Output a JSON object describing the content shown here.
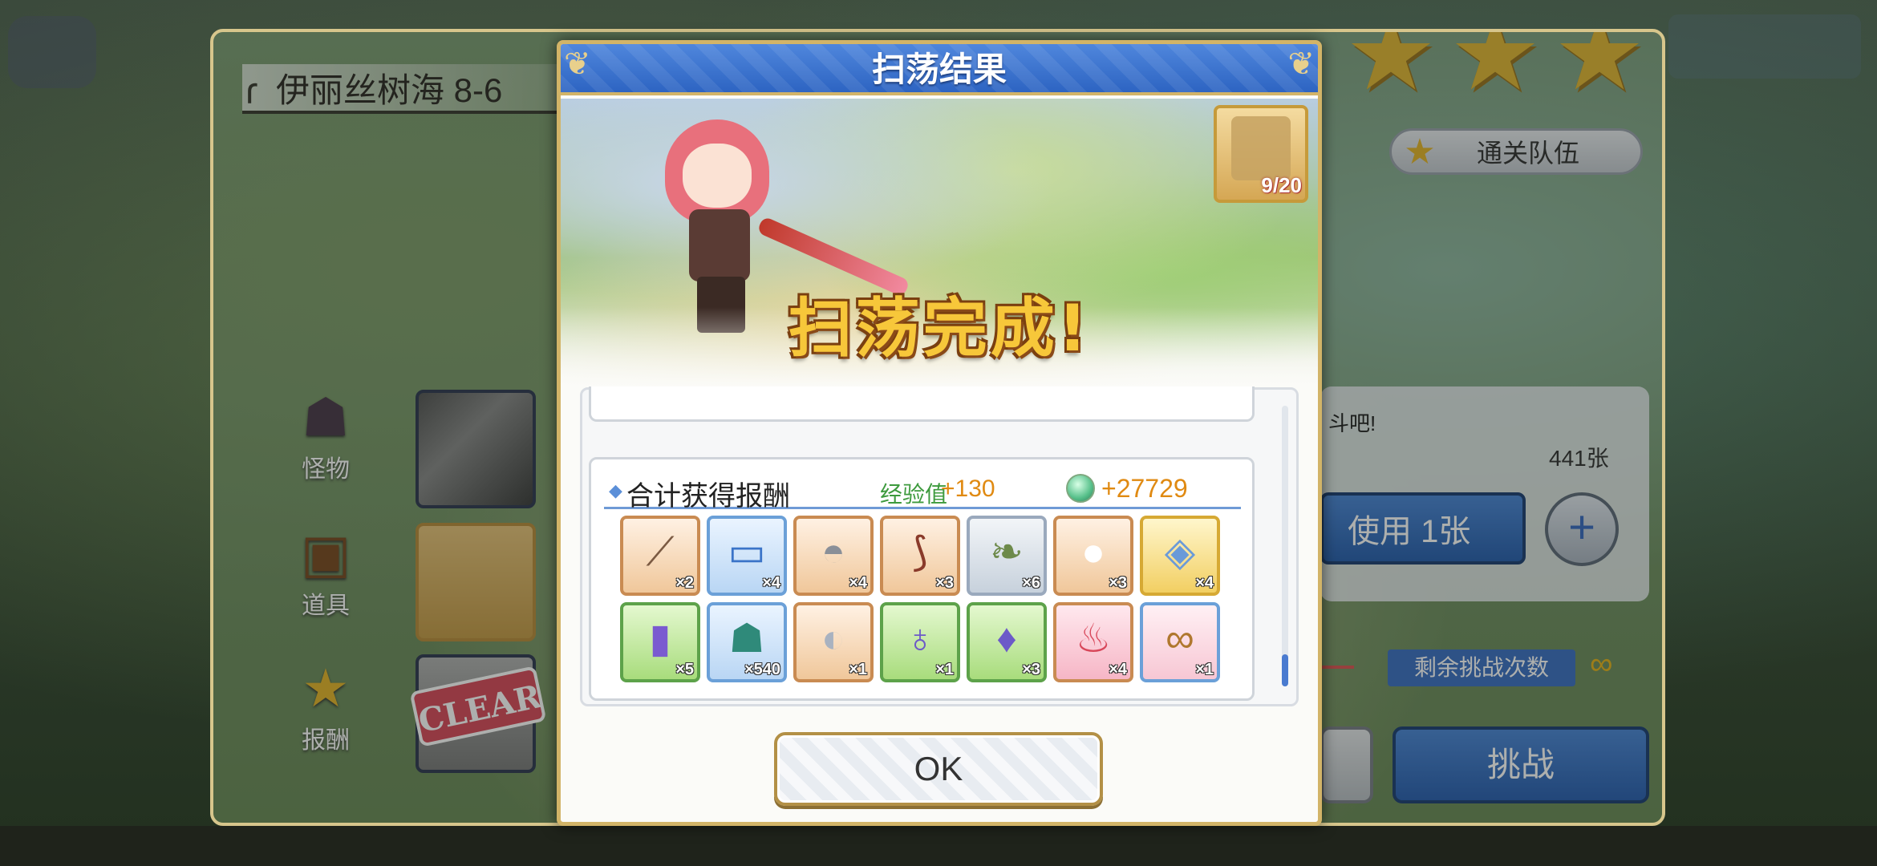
{
  "stage": {
    "title": "伊丽丝树海 8-6",
    "team_button_label": "通关队伍",
    "tip_text": "斗吧!",
    "tickets": "441张",
    "use_button_label": "使用 1张",
    "remaining_label": "剩余挑战次数",
    "remaining_value": "∞",
    "challenge_button_label": "挑战",
    "clear_stamp": "CLEAR",
    "stars_earned": 3
  },
  "side_menu": [
    {
      "label": "怪物",
      "icon": "monster-icon"
    },
    {
      "label": "道具",
      "icon": "chest-icon"
    },
    {
      "label": "报酬",
      "icon": "star-icon"
    }
  ],
  "modal": {
    "title": "扫荡结果",
    "banner": "扫荡完成!",
    "piece_counter": "9/20",
    "rewards": {
      "label": "合计获得报酬",
      "exp_label": "经验值",
      "exp_value": "+130",
      "mana_value": "+27729",
      "items": [
        {
          "icon": "staff-icon",
          "qty": "×2",
          "style": "bronze"
        },
        {
          "icon": "scroll-ticket-icon",
          "qty": "×4",
          "style": "blue"
        },
        {
          "icon": "helmet-icon",
          "qty": "×4",
          "style": "bronze"
        },
        {
          "icon": "bow-icon",
          "qty": "×3",
          "style": "bronze"
        },
        {
          "icon": "herb-icon",
          "qty": "×6",
          "style": "silver"
        },
        {
          "icon": "orb-icon",
          "qty": "×3",
          "style": "bronze"
        },
        {
          "icon": "gold-ring-icon",
          "qty": "×4",
          "style": "gold"
        },
        {
          "icon": "potion-tube-icon",
          "qty": "×5",
          "style": "green"
        },
        {
          "icon": "mana-bag-icon",
          "qty": "×540",
          "style": "blue"
        },
        {
          "icon": "bracelet-icon",
          "qty": "×1",
          "style": "bronze"
        },
        {
          "icon": "elixir-icon",
          "qty": "×1",
          "style": "green"
        },
        {
          "icon": "flask-icon",
          "qty": "×3",
          "style": "green"
        },
        {
          "icon": "cake-icon",
          "qty": "×4",
          "style": "bronze"
        },
        {
          "icon": "pretzel-icon",
          "qty": "×1",
          "style": "pink"
        }
      ]
    },
    "ok_label": "OK"
  }
}
